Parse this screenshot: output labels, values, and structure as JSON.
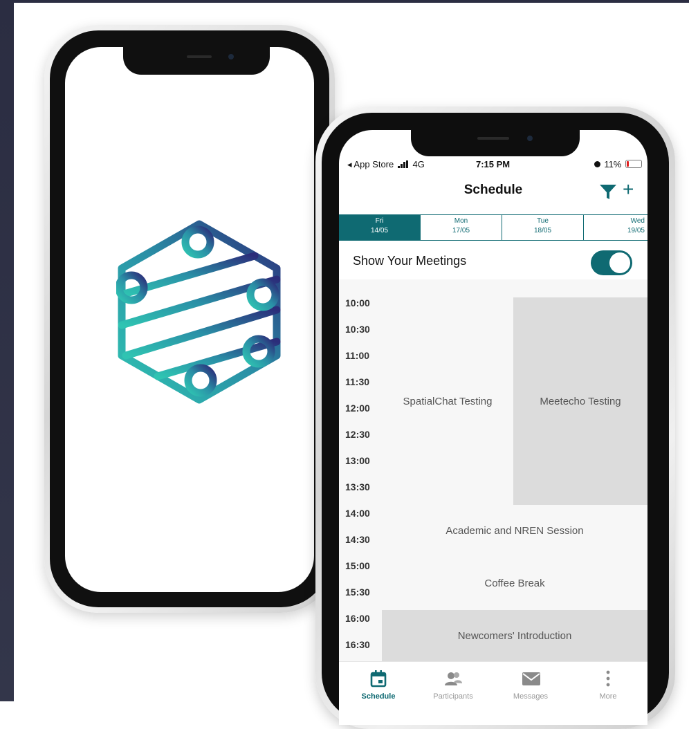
{
  "status_bar": {
    "back_label": "◂ App Store",
    "network": "4G",
    "time": "7:15 PM",
    "battery": "11%"
  },
  "navbar": {
    "title": "Schedule",
    "plus": "+"
  },
  "dates": [
    {
      "day": "Fri",
      "date": "14/05",
      "active": true
    },
    {
      "day": "Mon",
      "date": "17/05",
      "active": false
    },
    {
      "day": "Tue",
      "date": "18/05",
      "active": false
    },
    {
      "day": "Wed",
      "date": "19/05",
      "active": false
    }
  ],
  "meetings_toggle": {
    "label": "Show Your Meetings",
    "on": true
  },
  "times": [
    "10:00",
    "10:30",
    "11:00",
    "11:30",
    "12:00",
    "12:30",
    "13:00",
    "13:30",
    "14:00",
    "14:30",
    "15:00",
    "15:30",
    "16:00",
    "16:30"
  ],
  "events": {
    "spatial": "SpatialChat Testing",
    "meetecho": "Meetecho Testing",
    "academic": "Academic and NREN Session",
    "coffee": "Coffee Break",
    "newcomers": "Newcomers' Introduction"
  },
  "tabs": [
    {
      "label": "Schedule",
      "icon": "calendar-icon",
      "active": true
    },
    {
      "label": "Participants",
      "icon": "participants-icon",
      "active": false
    },
    {
      "label": "Messages",
      "icon": "envelope-icon",
      "active": false
    },
    {
      "label": "More",
      "icon": "more-vertical-icon",
      "active": false
    }
  ],
  "colors": {
    "accent": "#0f6a72",
    "event_block": "#dcdcdc",
    "logo_start": "#2fc4b2",
    "logo_end": "#2b2d7a"
  }
}
